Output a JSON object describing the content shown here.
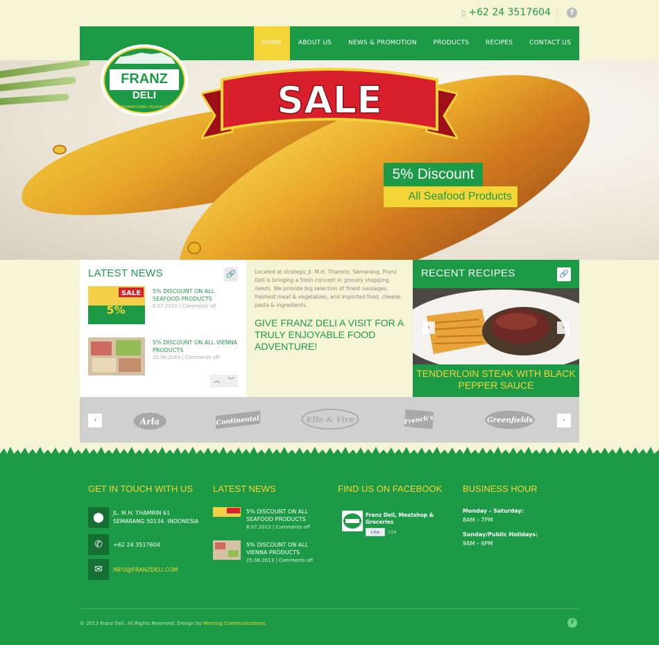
{
  "header": {
    "phone_icon": "phone-icon",
    "phone": "+62 24 3517604",
    "social_icon": "facebook-icon"
  },
  "nav": {
    "items": [
      {
        "label": "HOME",
        "active": true
      },
      {
        "label": "ABOUT US"
      },
      {
        "label": "NEWS & PROMOTION"
      },
      {
        "label": "PRODUCTS"
      },
      {
        "label": "RECIPES"
      },
      {
        "label": "CONTACT US"
      }
    ]
  },
  "logo": {
    "line1": "FRANZ",
    "line2": "DELI",
    "tagline": "INTERNATIONAL DELICACIES"
  },
  "hero": {
    "sale": "SALE",
    "discount": "5% Discount",
    "subtitle": "All Seafood Products"
  },
  "latest_news": {
    "title": "LATEST NEWS",
    "items": [
      {
        "title": "5% DISCOUNT ON ALL SEAFOOD PRODUCTS",
        "meta": "8.07.2013 | Comments off"
      },
      {
        "title": "5% DISCOUNT ON ALL VIENNA PRODUCTS",
        "meta": "25.06.2013 | Comments off"
      }
    ]
  },
  "middle": {
    "text": "Located at strategic Jl. M.H. Thamrin, Semarang, Franz Deli is bringing a fresh concept in grocery shopping needs. We provide big selection of finest sausages, freshest meat & vegetables, and imported food, cheese, pasta & ingredients.",
    "headline": "GIVE FRANZ DELI A VISIT FOR A TRULY ENJOYABLE FOOD ADVENTURE!"
  },
  "recipes": {
    "title": "RECENT RECIPES",
    "recipe_title": "TENDERLOIN STEAK WITH BLACK PEPPER SAUCE"
  },
  "brands": [
    "Arla",
    "Continental",
    "Elle & Vire",
    "French's",
    "Greenfields"
  ],
  "footer": {
    "contact_title": "GET IN TOUCH WITH US",
    "address": [
      "JL. M.H. THAMRIN 61",
      "SEMARANG 50134. INDONESIA"
    ],
    "phone": "+62 24 3517604",
    "email": "INFO@FRANZDELI.COM",
    "news_title": "LATEST NEWS",
    "news": [
      {
        "title": "5% DISCOUNT ON ALL SEAFOOD PRODUCTS",
        "meta": "8.07.2013 | Comments off"
      },
      {
        "title": "5% DISCOUNT ON ALL VIENNA PRODUCTS",
        "meta": "25.06.2013 | Comments off"
      }
    ],
    "facebook_title": "FIND US ON FACEBOOK",
    "fb_page": "Franz Deli, Meatshop & Groceries",
    "fb_like": "Like",
    "fb_count": "154",
    "hours_title": "BUSINESS HOUR",
    "weekday_label": "Monday - Saturday:",
    "weekday_hours": "8AM – 7PM",
    "holiday_label": "Sunday/Public Holidays:",
    "holiday_hours": "9AM – 6PM",
    "copyright": "© 2013 Franz Deli. All Rights Reserved. Design by",
    "designer": "Morning Communications."
  },
  "colors": {
    "brand_green": "#1c9a46",
    "accent_yellow": "#f4d538",
    "background": "#f6f4d6"
  }
}
